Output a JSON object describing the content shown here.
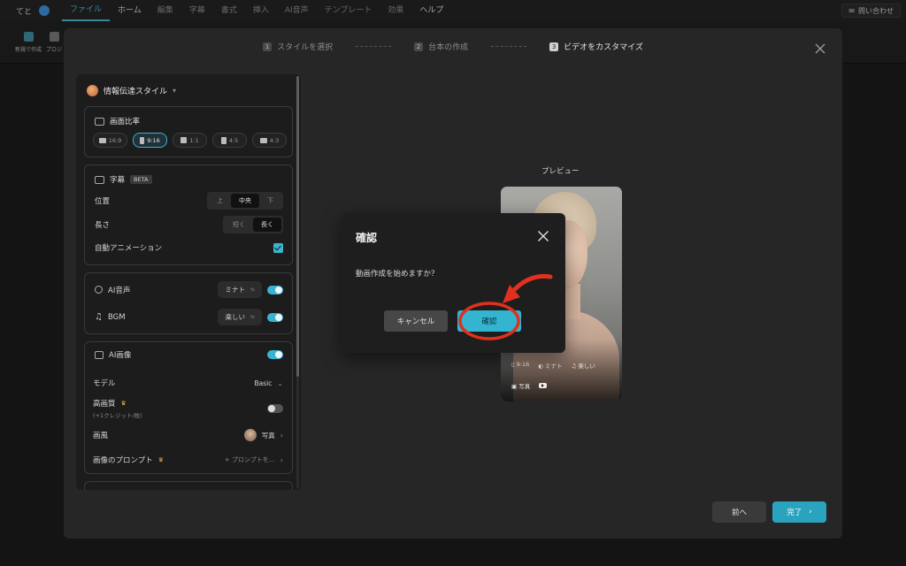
{
  "topbar": {
    "user_name": "てと",
    "menu": [
      "ファイル",
      "ホーム",
      "編集",
      "字幕",
      "書式",
      "挿入",
      "AI音声",
      "テンプレート",
      "効果",
      "ヘルプ"
    ],
    "active_index": 0,
    "contact_label": "問い合わせ"
  },
  "ribbon": {
    "new_label": "新規で作成",
    "project_label": "プロジ"
  },
  "steps": [
    {
      "num": "1",
      "label": "スタイルを選択"
    },
    {
      "num": "2",
      "label": "台本の作成"
    },
    {
      "num": "3",
      "label": "ビデオをカスタマイズ"
    }
  ],
  "panel": {
    "style_title": "情報伝達スタイル",
    "ratio": {
      "title": "画面比率",
      "options": [
        "16:9",
        "9:16",
        "1:1",
        "4:5",
        "4:3"
      ],
      "selected": "9:16"
    },
    "subtitle": {
      "title": "字幕",
      "badge": "BETA",
      "position_label": "位置",
      "position_options": [
        "上",
        "中央",
        "下"
      ],
      "position_selected": "中央",
      "length_label": "長さ",
      "length_options": [
        "短く",
        "長く"
      ],
      "length_selected": "長く",
      "auto_anim_label": "自動アニメーション",
      "auto_anim_checked": true
    },
    "audio": {
      "voice_label": "AI音声",
      "voice_value": "ミナト",
      "voice_on": true,
      "bgm_label": "BGM",
      "bgm_value": "楽しい",
      "bgm_on": true
    },
    "image": {
      "title": "AI画像",
      "on": true,
      "model_label": "モデル",
      "model_value": "Basic",
      "hq_label": "高画質",
      "hq_sub": "(+1クレジット/枚)",
      "hq_on": false,
      "style_label": "画風",
      "style_value": "写真",
      "prompt_label": "画像のプロンプト",
      "prompt_value": "+ プロンプトを…"
    }
  },
  "preview": {
    "label": "プレビュー",
    "ratio": "9:16",
    "voice": "ミナト",
    "bgm": "楽しい",
    "image_style": "写真"
  },
  "footer": {
    "prev_label": "前へ",
    "done_label": "完了"
  },
  "dialog": {
    "title": "確認",
    "message": "動画作成を始めますか？",
    "cancel_label": "キャンセル",
    "confirm_label": "確認"
  },
  "colors": {
    "accent": "#33b4d0",
    "annotation": "#e0301e"
  }
}
